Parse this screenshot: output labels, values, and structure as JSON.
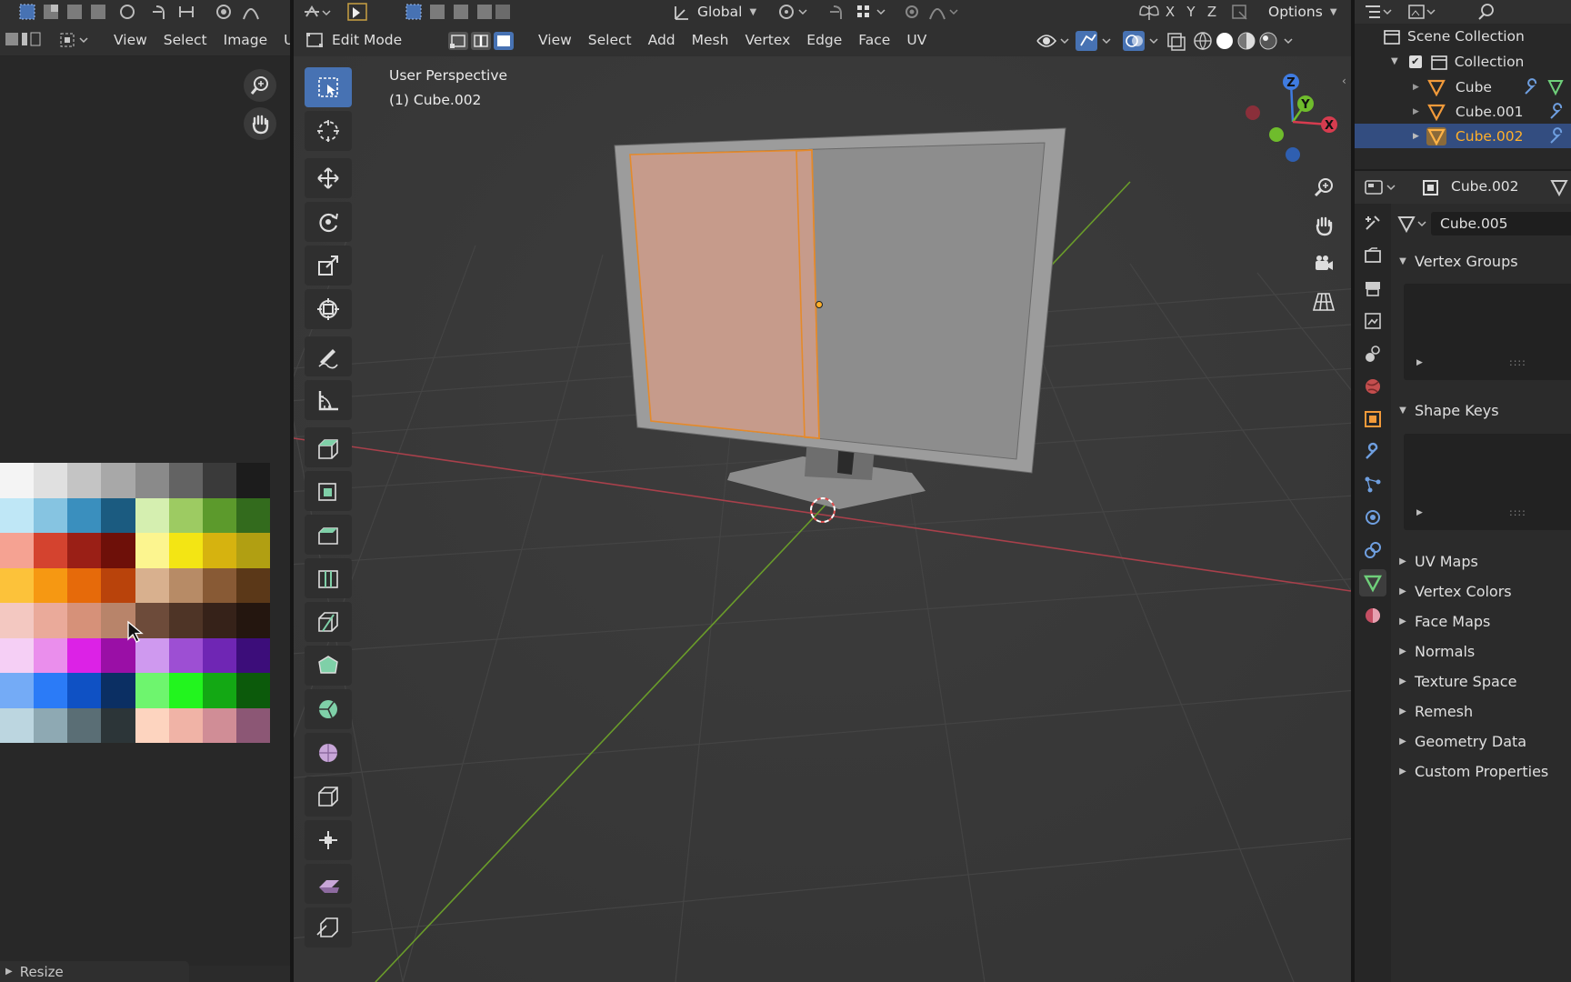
{
  "left_editor": {
    "menu": [
      "View",
      "Select",
      "Image",
      "U"
    ],
    "operator_panel": "Resize"
  },
  "palette": {
    "colors": [
      "#f4f4f4",
      "#e0e0e0",
      "#c4c4c4",
      "#a8a8a8",
      "#8a8a8a",
      "#636363",
      "#3a3a3a",
      "#1c1c1c",
      "#bfe7f6",
      "#86c4e1",
      "#3a8fbe",
      "#1b5b80",
      "#d5efb0",
      "#9dcb62",
      "#5c9a2c",
      "#336b1d",
      "#f5a292",
      "#d4432f",
      "#9a1f16",
      "#6e1009",
      "#fcf58f",
      "#f3e514",
      "#d6b30f",
      "#b19f12",
      "#fcc23a",
      "#f69812",
      "#e66a0a",
      "#b9430b",
      "#d8b08e",
      "#b78b66",
      "#885a35",
      "#5b3818",
      "#f3c8c1",
      "#eaaa9a",
      "#d69179",
      "#b8846a",
      "#6d4b3a",
      "#4e3426",
      "#362219",
      "#24160f",
      "#f5cff5",
      "#ea8eec",
      "#dc22e6",
      "#9a0fa6",
      "#cf99ef",
      "#9d4fd3",
      "#6f26b4",
      "#3c0d7a",
      "#74abf6",
      "#2b7bf7",
      "#0f51c4",
      "#0b2f63",
      "#6ef56e",
      "#22f51e",
      "#13a814",
      "#0c5a0b",
      "#bcd6e0",
      "#8ea9b3",
      "#5a6e75",
      "#2c3538",
      "#fdd4bf",
      "#f0b3a6",
      "#d08d96",
      "#8c5775"
    ]
  },
  "viewport": {
    "transform_orientation": "Global",
    "mode": "Edit Mode",
    "menu": [
      "View",
      "Select",
      "Add",
      "Mesh",
      "Vertex",
      "Edge",
      "Face",
      "UV"
    ],
    "axes_lock": [
      "X",
      "Y",
      "Z"
    ],
    "options_label": "Options",
    "overlay_line1": "User Perspective",
    "overlay_line2": "(1) Cube.002",
    "gizmo_labels": {
      "z": "Z",
      "y": "Y",
      "x": "X"
    }
  },
  "outliner": {
    "scene_collection": "Scene Collection",
    "collection": "Collection",
    "objects": [
      "Cube",
      "Cube.001",
      "Cube.002"
    ],
    "selected_index": 2
  },
  "properties": {
    "object_name": "Cube.002",
    "mesh_name": "Cube.005",
    "panels_open": [
      "Vertex Groups",
      "Shape Keys"
    ],
    "panels_closed": [
      "UV Maps",
      "Vertex Colors",
      "Face Maps",
      "Normals",
      "Texture Space",
      "Remesh",
      "Geometry Data",
      "Custom Properties"
    ]
  },
  "colors": {
    "accent_blue": "#4772b3",
    "selected_orange": "#ffaf29",
    "face_select": "#f5a88a",
    "x_axis": "#d63c4f",
    "y_axis": "#6fbc2c",
    "z_axis": "#3f7be0"
  }
}
